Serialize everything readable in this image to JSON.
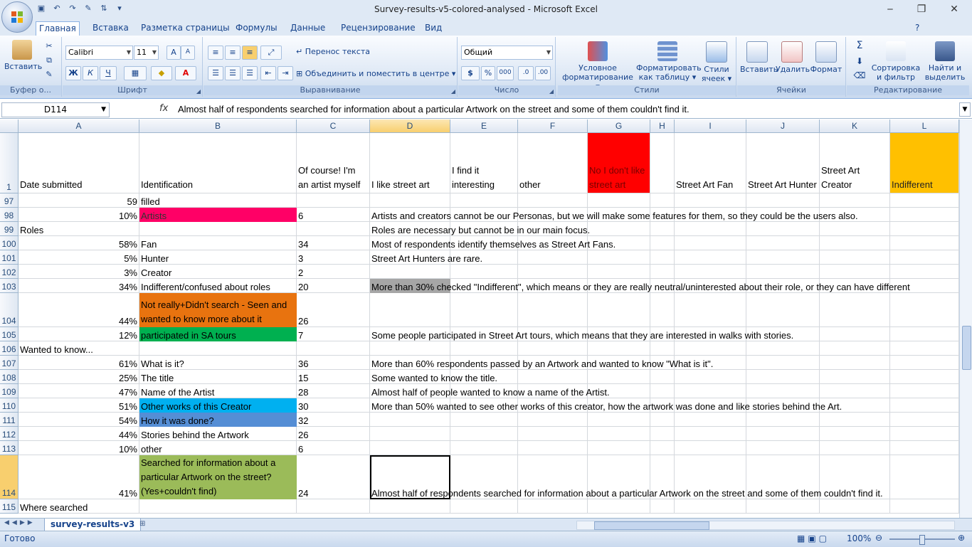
{
  "window": {
    "title": "Survey-results-v5-colored-analysed - Microsoft Excel"
  },
  "tabs": [
    "Главная",
    "Вставка",
    "Разметка страницы",
    "Формулы",
    "Данные",
    "Рецензирование",
    "Вид"
  ],
  "ribbon": {
    "clipboard": {
      "paste": "Вставить",
      "group": "Буфер о..."
    },
    "font": {
      "name": "Calibri",
      "size": "11",
      "bold": "Ж",
      "italic": "К",
      "underline": "Ч",
      "group": "Шрифт"
    },
    "alignment": {
      "wrap": "Перенос текста",
      "merge": "Объединить и поместить в центре",
      "group": "Выравнивание"
    },
    "number": {
      "format": "Общий",
      "group": "Число"
    },
    "styles": {
      "cond": "Условное форматирование",
      "table": "Форматировать как таблицу",
      "cell": "Стили ячеек",
      "group": "Стили"
    },
    "cells": {
      "insert": "Вставить",
      "delete": "Удалить",
      "format": "Формат",
      "group": "Ячейки"
    },
    "editing": {
      "sort": "Сортировка и фильтр",
      "find": "Найти и выделить",
      "group": "Редактирование"
    }
  },
  "formula_bar": {
    "name_box": "D114",
    "fx": "fx",
    "content": "Almost half of respondents searched for information about a particular Artwork on the street and some of them couldn't find it."
  },
  "columns": [
    "A",
    "B",
    "C",
    "D",
    "E",
    "F",
    "G",
    "H",
    "I",
    "J",
    "K",
    "L"
  ],
  "header_row": {
    "num": "1",
    "cells": [
      "Date submitted",
      "Identification",
      "Of course! I'm an artist myself",
      "I like street art",
      "I find it interesting",
      "other",
      "No I don't like street art",
      "",
      "Street Art Fan",
      "Street Art Hunter",
      "Street Art Creator",
      "Indifferent"
    ]
  },
  "rows": [
    {
      "num": "97",
      "a": "59",
      "b": "filled",
      "c": "",
      "d": ""
    },
    {
      "num": "98",
      "a": "10%",
      "b": "Artists",
      "c": "6",
      "d": "Artists and creators cannot be our Personas, but we will make some features for them, so they could be the users also."
    },
    {
      "num": "99",
      "a": "Roles",
      "b": "",
      "c": "",
      "d": "Roles are necessary but cannot be in our main focus."
    },
    {
      "num": "100",
      "a": "58%",
      "b": "Fan",
      "c": "34",
      "d": "Most of respondents identify themselves as Street Art Fans."
    },
    {
      "num": "101",
      "a": "5%",
      "b": "Hunter",
      "c": "3",
      "d": "Street Art Hunters are rare."
    },
    {
      "num": "102",
      "a": "3%",
      "b": "Creator",
      "c": "2",
      "d": ""
    },
    {
      "num": "103",
      "a": "34%",
      "b": "Indifferent/confused about roles",
      "c": "20",
      "d": "More than 30% checked \"Indifferent\", which means or they are really neutral/uninterested about their role, or they can have different"
    },
    {
      "num": "104",
      "a": "44%",
      "b": "Not really+Didn't search - Seen and wanted to know more about it",
      "c": "26",
      "d": ""
    },
    {
      "num": "105",
      "a": "12%",
      "b": "participated in SA tours",
      "c": "7",
      "d": "Some people participated in Street Art tours, which means that they are interested in walks with stories."
    },
    {
      "num": "106",
      "a": "Wanted to know...",
      "b": "",
      "c": "",
      "d": ""
    },
    {
      "num": "107",
      "a": "61%",
      "b": "What is it?",
      "c": "36",
      "d": "More than 60% respondents passed by an Artwork and wanted to know \"What is it\"."
    },
    {
      "num": "108",
      "a": "25%",
      "b": "The title",
      "c": "15",
      "d": "Some wanted to know the title."
    },
    {
      "num": "109",
      "a": "47%",
      "b": "Name of the Artist",
      "c": "28",
      "d": "Almost half of people wanted to know a name of the Artist."
    },
    {
      "num": "110",
      "a": "51%",
      "b": "Other works of this Creator",
      "c": "30",
      "d": "More than 50% wanted to see other works of this creator, how the artwork was done and like stories behind the Art."
    },
    {
      "num": "111",
      "a": "54%",
      "b": "How it was done?",
      "c": "32",
      "d": ""
    },
    {
      "num": "112",
      "a": "44%",
      "b": "Stories behind the Artwork",
      "c": "26",
      "d": ""
    },
    {
      "num": "113",
      "a": "10%",
      "b": "other",
      "c": "6",
      "d": ""
    },
    {
      "num": "114",
      "a": "41%",
      "b": "Searched for information about a particular Artwork on the street? (Yes+couldn't find)",
      "c": "24",
      "d": "Almost half of respondents searched for information about a particular Artwork on the street and some of them couldn't find it."
    },
    {
      "num": "115",
      "a": "Where searched",
      "b": "",
      "c": "",
      "d": ""
    }
  ],
  "colors": {
    "pink": "#ff0066",
    "red": "#ff0000",
    "orange": "#e8730f",
    "green": "#00b050",
    "gold": "#ffc000",
    "cyan": "#00b0f0",
    "blue": "#558ed5",
    "olive": "#9bbb59",
    "grey": "#a6a6a6"
  },
  "sheet": {
    "tab": "survey-results-v3"
  },
  "status": {
    "ready": "Готово",
    "zoom": "100%"
  }
}
